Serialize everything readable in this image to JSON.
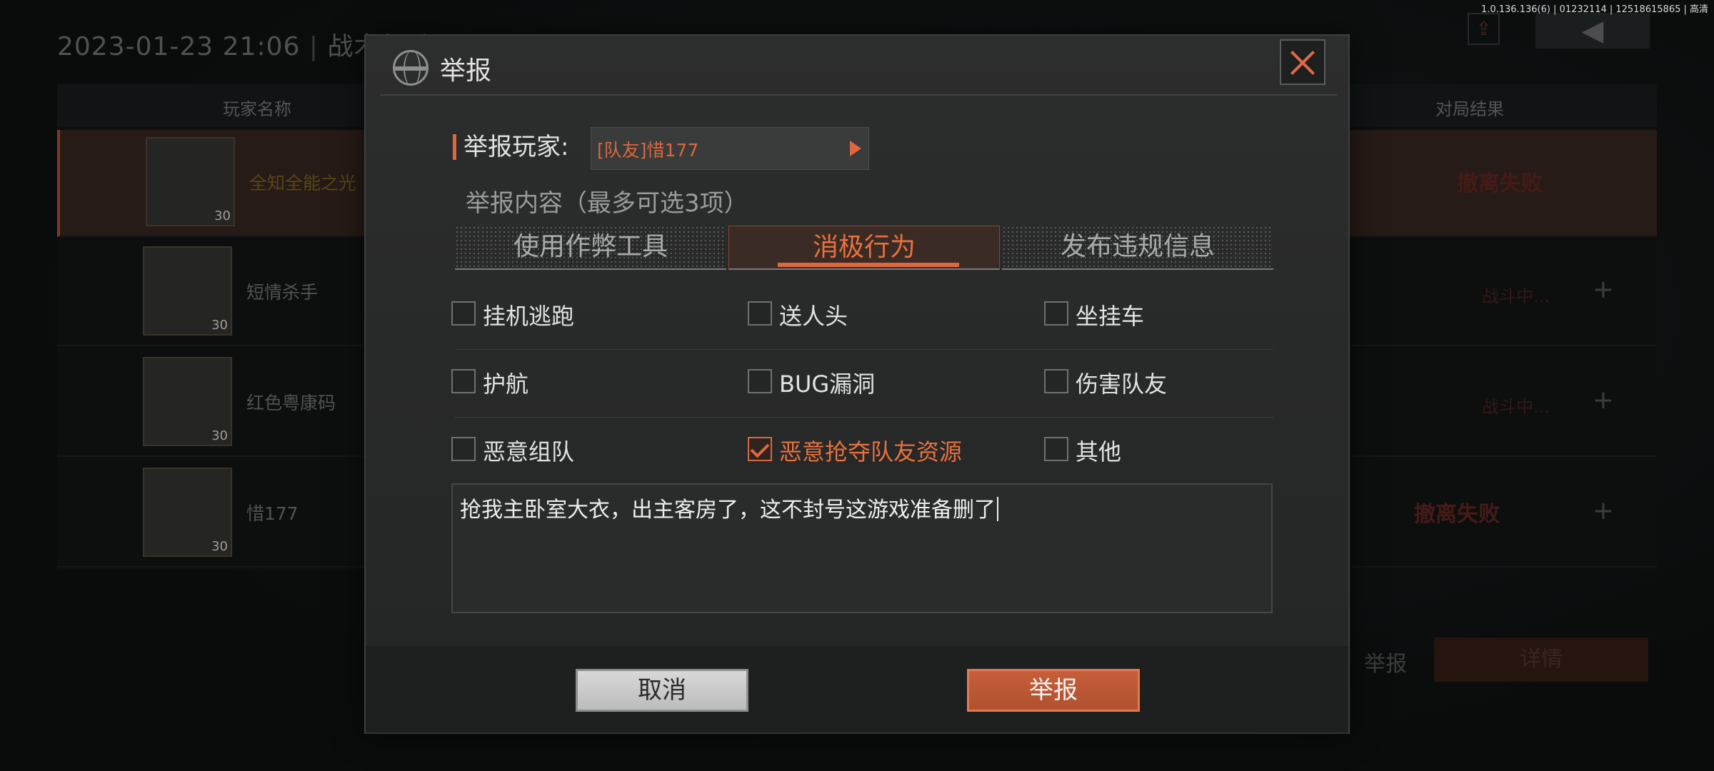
{
  "version_info": "1.0.136.136(6) | 01232114 | 12518615865 | 高清",
  "background": {
    "datetime": "2023-01-23 21:06",
    "mode": "战术行动",
    "col_player_name": "玩家名称",
    "col_result": "对局结果",
    "players": [
      {
        "name": "全知全能之光",
        "level": "30",
        "result": "撤离失败",
        "status": ""
      },
      {
        "name": "短情杀手",
        "level": "30",
        "result": "",
        "status": "战斗中..."
      },
      {
        "name": "红色粤康码",
        "level": "30",
        "result": "",
        "status": "战斗中..."
      },
      {
        "name": "惜177",
        "level": "30",
        "result": "撤离失败",
        "status": ""
      }
    ],
    "report_label": "举报",
    "detail_label": "详情"
  },
  "dialog": {
    "title": "举报",
    "player_label": "举报玩家:",
    "player_value": "[队友]惜177",
    "content_label": "举报内容（最多可选3项）",
    "tabs": [
      {
        "label": "使用作弊工具",
        "active": false
      },
      {
        "label": "消极行为",
        "active": true
      },
      {
        "label": "发布违规信息",
        "active": false
      }
    ],
    "options": [
      {
        "label": "挂机逃跑",
        "checked": false
      },
      {
        "label": "送人头",
        "checked": false
      },
      {
        "label": "坐挂车",
        "checked": false
      },
      {
        "label": "护航",
        "checked": false
      },
      {
        "label": "BUG漏洞",
        "checked": false
      },
      {
        "label": "伤害队友",
        "checked": false
      },
      {
        "label": "恶意组队",
        "checked": false
      },
      {
        "label": "恶意抢夺队友资源",
        "checked": true
      },
      {
        "label": "其他",
        "checked": false
      }
    ],
    "reason_text": "抢我主卧室大衣，出主客房了，这不封号这游戏准备删了",
    "cancel_label": "取消",
    "submit_label": "举报"
  },
  "accent_color": "#e0673d"
}
